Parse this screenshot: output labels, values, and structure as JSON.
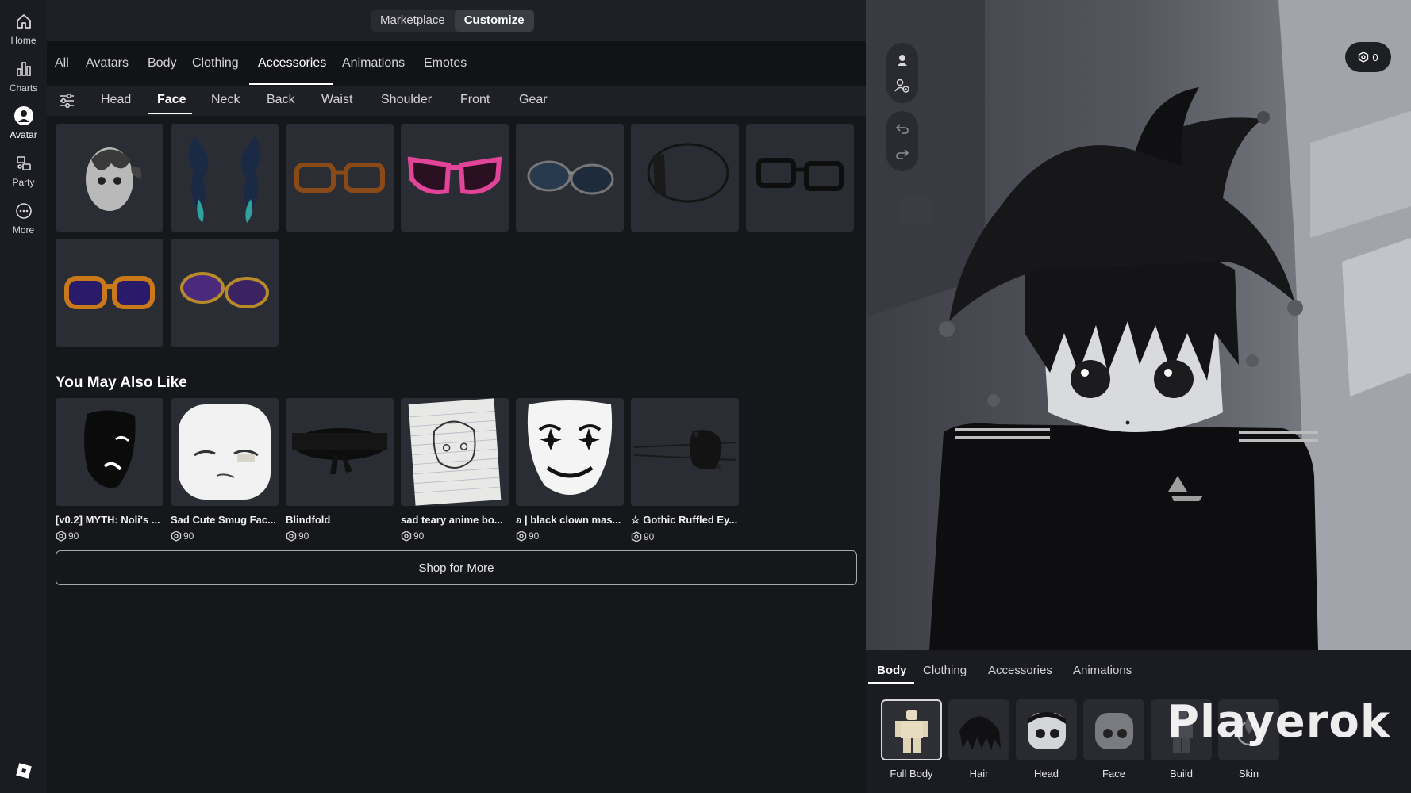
{
  "left_nav": {
    "items": [
      {
        "label": "Home",
        "icon": "home-icon"
      },
      {
        "label": "Charts",
        "icon": "charts-icon"
      },
      {
        "label": "Avatar",
        "icon": "avatar-icon"
      },
      {
        "label": "Party",
        "icon": "party-icon"
      },
      {
        "label": "More",
        "icon": "more-icon"
      }
    ],
    "active": "Avatar"
  },
  "header": {
    "segments": [
      "Marketplace",
      "Customize"
    ],
    "active_segment": "Customize"
  },
  "category_tabs": {
    "items": [
      "All",
      "Avatars",
      "Body",
      "Clothing",
      "Accessories",
      "Animations",
      "Emotes"
    ],
    "active": "Accessories"
  },
  "sub_tabs": {
    "items": [
      "Head",
      "Face",
      "Neck",
      "Back",
      "Waist",
      "Shoulder",
      "Front",
      "Gear"
    ],
    "active": "Face"
  },
  "owned_items": [
    {
      "thumb": "zombie-mask"
    },
    {
      "thumb": "blue-flame-wisps"
    },
    {
      "thumb": "brown-glasses"
    },
    {
      "thumb": "pink-sunglasses"
    },
    {
      "thumb": "aviator-sunglasses"
    },
    {
      "thumb": "black-visor"
    },
    {
      "thumb": "black-glasses"
    },
    {
      "thumb": "orange-purple-shades"
    },
    {
      "thumb": "gold-purple-aviators"
    }
  ],
  "recommendations": {
    "heading": "You May Also Like",
    "items": [
      {
        "name": "[v0.2] MYTH: Noli's ...",
        "price": "90",
        "thumb": "black-sad-mask"
      },
      {
        "name": "Sad Cute Smug Fac...",
        "price": "90",
        "thumb": "smug-face"
      },
      {
        "name": "Blindfold",
        "price": "90",
        "thumb": "blindfold"
      },
      {
        "name": "sad teary anime bo...",
        "price": "90",
        "thumb": "anime-sketch"
      },
      {
        "name": "ʚ | black clown mas...",
        "price": "90",
        "thumb": "clown-mask"
      },
      {
        "name": "☆ Gothic Ruffled Ey...",
        "price": "90",
        "thumb": "gothic-eyepatch"
      }
    ],
    "shop_more_label": "Shop for More"
  },
  "viewport": {
    "robux_balance": "0"
  },
  "editor": {
    "tabs": [
      "Body",
      "Clothing",
      "Accessories",
      "Animations"
    ],
    "active_tab": "Body",
    "items": [
      {
        "label": "Full Body",
        "active": true
      },
      {
        "label": "Hair",
        "active": false
      },
      {
        "label": "Head",
        "active": false
      },
      {
        "label": "Face",
        "active": false
      },
      {
        "label": "Build",
        "active": false
      },
      {
        "label": "Skin",
        "active": false
      }
    ]
  },
  "watermark": "Playerok",
  "colors": {
    "panel_bg": "#16171b",
    "tile_bg": "#2b2d34",
    "accent_white": "#ffffff"
  }
}
